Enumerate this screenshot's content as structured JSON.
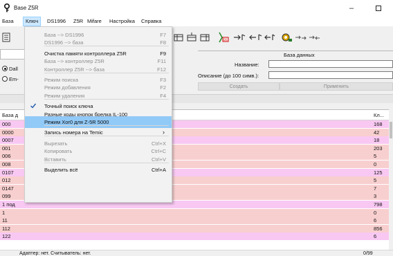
{
  "window": {
    "title": "Base Z5R"
  },
  "menubar": [
    "База",
    "Ключ",
    "DS1996",
    "Z5R",
    "Mifare",
    "Настройка",
    "Справка"
  ],
  "panel": {
    "header": "База данных",
    "radio1_label": "Dall",
    "radio2_label": "Em-",
    "name_label": "Название:",
    "desc_label": "Описание (до 100 симв.):",
    "create_label": "Создать",
    "apply_label": "Применить"
  },
  "table": {
    "col0": "База д",
    "col1": "Кл...",
    "rows": [
      {
        "c0": "000",
        "c1": "168"
      },
      {
        "c0": "0000",
        "c1": "42"
      },
      {
        "c0": "0007",
        "c1": "18"
      },
      {
        "c0": "001",
        "c1": "203"
      },
      {
        "c0": "006",
        "c1": "5"
      },
      {
        "c0": "008",
        "c1": "0"
      },
      {
        "c0": "0107",
        "c1": "125"
      },
      {
        "c0": "012",
        "c1": "5"
      },
      {
        "c0": "0147",
        "c1": "7"
      },
      {
        "c0": "099",
        "c1": "3"
      },
      {
        "c0": "1 под",
        "c1": "798"
      },
      {
        "c0": "1",
        "c1": "0"
      },
      {
        "c0": "11",
        "c1": "6"
      },
      {
        "c0": "112",
        "c1": "856"
      },
      {
        "c0": "122",
        "c1": "6"
      }
    ]
  },
  "dropdown": [
    {
      "label": "База --> DS1996",
      "short": "F7",
      "disabled": true
    },
    {
      "label": "DS1996 --> база",
      "short": "F8",
      "disabled": true
    },
    {
      "sep": true
    },
    {
      "label": "Очистка памяти контроллера Z5R",
      "short": "F9",
      "disabled": false
    },
    {
      "label": "База --> контроллер Z5R",
      "short": "F11",
      "disabled": true
    },
    {
      "label": "Контроллер Z5R --> база",
      "short": "F12",
      "disabled": true
    },
    {
      "sep": true
    },
    {
      "label": "Режим поиска",
      "short": "F3",
      "disabled": true
    },
    {
      "label": "Режим добавления",
      "short": "F2",
      "disabled": true
    },
    {
      "label": "Режим удаления",
      "short": "F4",
      "disabled": true
    },
    {
      "sep": true
    },
    {
      "label": "Точный поиск ключа",
      "short": "",
      "disabled": false,
      "checked": true
    },
    {
      "label": "Разные коды кнопок брелка IL-100",
      "short": "",
      "disabled": false
    },
    {
      "label": "Режим Xor0 для Z-5R 5000",
      "short": "",
      "disabled": false,
      "highlight": true
    },
    {
      "sep": true
    },
    {
      "label": "Запись номера на Temic",
      "short": "",
      "disabled": false,
      "submenu": true
    },
    {
      "sep": true
    },
    {
      "label": "Вырезать",
      "short": "Ctrl+X",
      "disabled": true
    },
    {
      "label": "Копировать",
      "short": "Ctrl+C",
      "disabled": true
    },
    {
      "label": "Вставить",
      "short": "Ctrl+V",
      "disabled": true
    },
    {
      "sep": true
    },
    {
      "label": "Выделить всё",
      "short": "Ctrl+A",
      "disabled": false
    }
  ],
  "status": {
    "left": "Адаптер: нет. Считыватель: нет.",
    "right": "0/99"
  },
  "colors": {
    "row_pink": "#f8c8f2",
    "row_salmon": "#f8cfcf",
    "highlight": "#91c9f7"
  }
}
